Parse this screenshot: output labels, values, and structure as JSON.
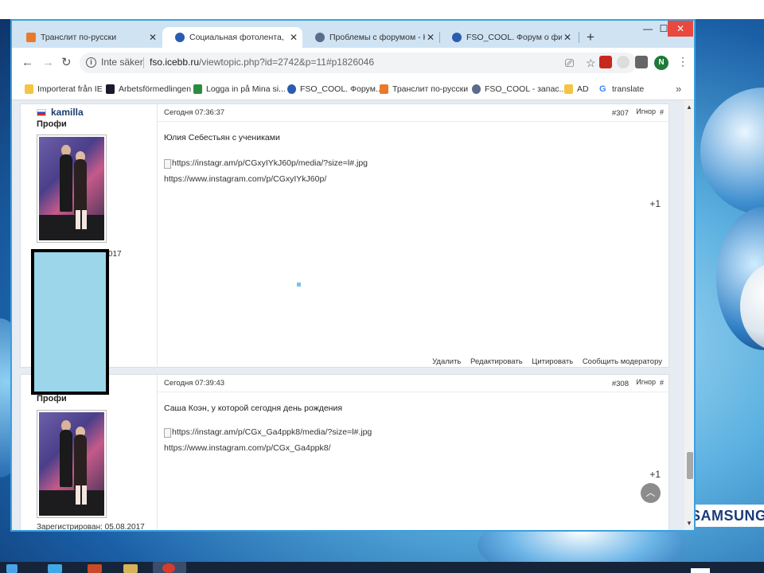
{
  "browser": {
    "tabs": [
      {
        "label": "Транслит по-русски",
        "icon": "translit-favicon",
        "active": false
      },
      {
        "label": "Социальная фотолента, часть",
        "icon": "forum-favicon",
        "active": true
      },
      {
        "label": "Проблемы с форумом - Начал",
        "icon": "forum-favicon",
        "active": false
      },
      {
        "label": "FSO_COOL. Форум о фигурном",
        "icon": "forum-favicon",
        "active": false
      }
    ],
    "tab_close_glyph": "✕",
    "new_tab_glyph": "+",
    "window": {
      "minimize": "—",
      "maximize": "☐",
      "close": "✕"
    },
    "address": {
      "security_label": "Inte säker",
      "host": "fso.icebb.ru",
      "path": "/viewtopic.php?id=2742&p=11#p1826046"
    },
    "profile_initial": "N",
    "bookmarks": [
      {
        "label": "Importerat från IE",
        "icon": "folder-icon",
        "color": "#f4c542"
      },
      {
        "label": "Arbetsförmedlingen",
        "icon": "af-icon",
        "color": "#1a1a2e"
      },
      {
        "label": "Logga in på Mina si...",
        "icon": "mina-sidor-icon",
        "color": "#2e8b3e"
      },
      {
        "label": "FSO_COOL. Форум...",
        "icon": "forum-favicon",
        "color": "#2a5db0"
      },
      {
        "label": "Транслит по-русски",
        "icon": "translit-favicon",
        "color": "#e87a2a"
      },
      {
        "label": "FSO_COOL - запас...",
        "icon": "forum-favicon",
        "color": "#5a6b8c"
      },
      {
        "label": "AD",
        "icon": "folder-icon",
        "color": "#f4c542"
      },
      {
        "label": "translate",
        "icon": "google-icon",
        "color": "#4285f4"
      }
    ],
    "bookmarks_more": "»"
  },
  "posts": [
    {
      "author": "kamilla",
      "rank": "Профи",
      "registered_partial": "8.2017",
      "date": "Сегодня 07:36:37",
      "number": "#307",
      "ignore": "Игнор",
      "hash": "#",
      "text": "Юлия Себестьян с учениками",
      "image_alt": "https://instagr.am/p/CGxyIYkJ60p/media/?size=l#.jpg",
      "link": "https://www.instagram.com/p/CGxyIYkJ60p/",
      "plus": "+1",
      "actions": [
        "Удалить",
        "Редактировать",
        "Цитировать",
        "Сообщить модератору"
      ]
    },
    {
      "rank": "Профи",
      "registered": "Зарегистрирован: 05.08.2017",
      "date": "Сегодня 07:39:43",
      "number": "#308",
      "ignore": "Игнор",
      "hash": "#",
      "text": "Саша Коэн, у которой сегодня день рождения",
      "image_alt": "https://instagr.am/p/CGx_Ga4ppk8/media/?size=l#.jpg",
      "link": "https://www.instagram.com/p/CGx_Ga4ppk8/",
      "plus": "+1"
    }
  ],
  "desktop": {
    "brand": "SAMSUNG"
  },
  "colors": {
    "window_border": "#3aa0e0",
    "tabbar_bg": "#cfe3f3",
    "redaction": "#9cd6ea"
  }
}
